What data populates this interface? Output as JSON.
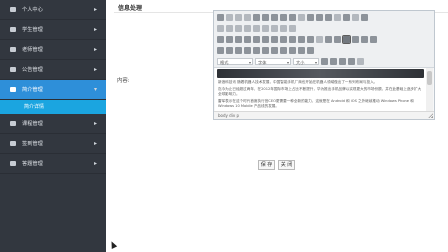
{
  "sidebar": {
    "items": [
      {
        "label": "个人中心",
        "icon": "user-icon"
      },
      {
        "label": "学生管理",
        "icon": "student-icon"
      },
      {
        "label": "老师管理",
        "icon": "teacher-icon"
      },
      {
        "label": "公告管理",
        "icon": "notice-icon"
      },
      {
        "label": "简介管理",
        "icon": "intro-icon"
      },
      {
        "label": "课程管理",
        "icon": "course-icon"
      },
      {
        "label": "签到管理",
        "icon": "checkin-icon"
      },
      {
        "label": "答题管理",
        "icon": "quiz-icon"
      }
    ],
    "active_index": 4,
    "submenu_label": "简介详情",
    "arrow_glyph": "▸",
    "arrow_open_glyph": "▾"
  },
  "main": {
    "title": "信息处理",
    "content_label": "内容:",
    "editor": {
      "format_select": "格式",
      "font_select": "字体",
      "size_select": "大小",
      "paragraphs": [
        "新浪科技讯 随着机器人技术发展，中国智能手机厂商也开始在机器人领域做出了一系列布局与投入。",
        "迄今为止已经超过两年，在2012年国际市场上占比不断提升，华为推出手机品牌以实现更大的市场份额，并在此基础上逐步扩大全球影响力。",
        "雷军表示在这个时代首席执行官CEO更需要一种全新的能力，这就是在 Android 和 iOS 之外继续推动 Windows Phone 和 Windows 10 Mobile 产品线的发展。"
      ],
      "statusbar": "body  div  p"
    },
    "buttons": {
      "save": "保 存",
      "close": "关 闭"
    }
  },
  "colors": {
    "sidebar_bg": "#32373f",
    "active_bg": "#2e8fd9",
    "submenu_bg": "#1ba5e0"
  }
}
